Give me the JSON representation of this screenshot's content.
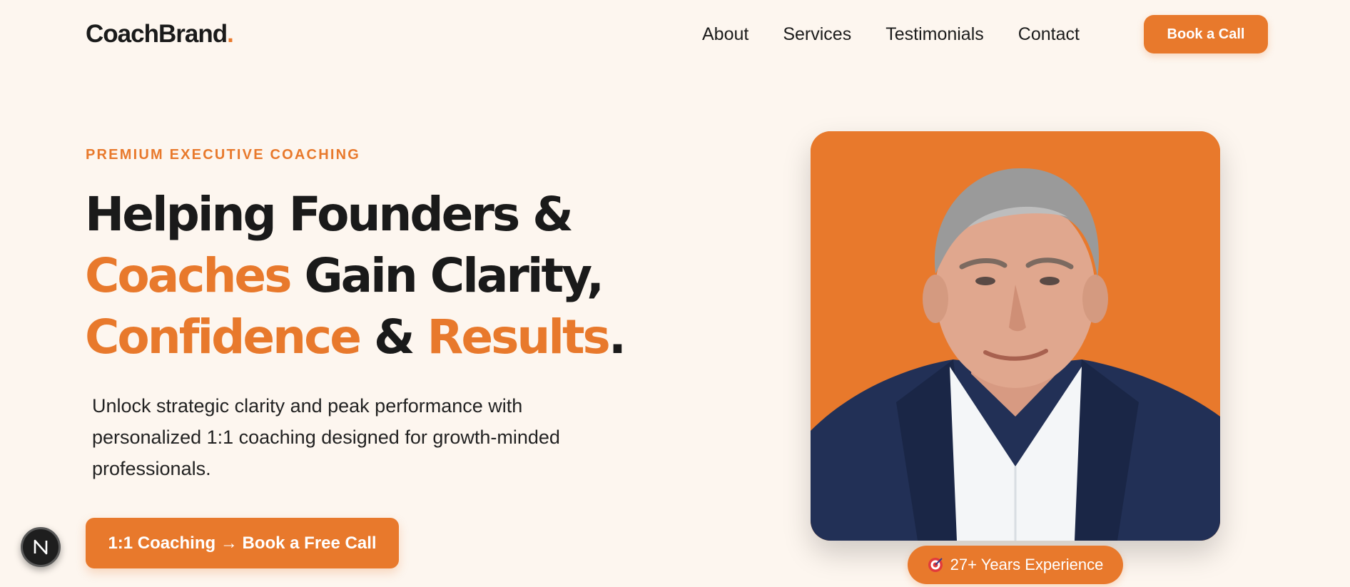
{
  "nav": {
    "brand": "CoachBrand",
    "brand_dot": ".",
    "links": [
      "About",
      "Services",
      "Testimonials",
      "Contact"
    ],
    "cta": "Book a Call"
  },
  "hero": {
    "eyebrow": "PREMIUM EXECUTIVE COACHING",
    "headline": {
      "line1": "Helping Founders &",
      "line2_orange": "Coaches",
      "line2_rest": " Gain Clarity,",
      "line3_orange1": "Confidence",
      "line3_mid": " & ",
      "line3_orange2": "Results",
      "line3_end": "."
    },
    "subtext": "Unlock strategic clarity and peak performance with personalized 1:1 coaching designed for growth-minded professionals.",
    "cta": "1:1 Coaching → Book a Free Call",
    "badge": {
      "icon": "target-icon",
      "label": "27+ Years Experience"
    },
    "portrait_icon": "portrait-photo"
  },
  "floating_badge": {
    "letter": "N"
  },
  "colors": {
    "accent": "#e8792c",
    "background": "#fdf6ef",
    "text": "#1a1a1a"
  }
}
